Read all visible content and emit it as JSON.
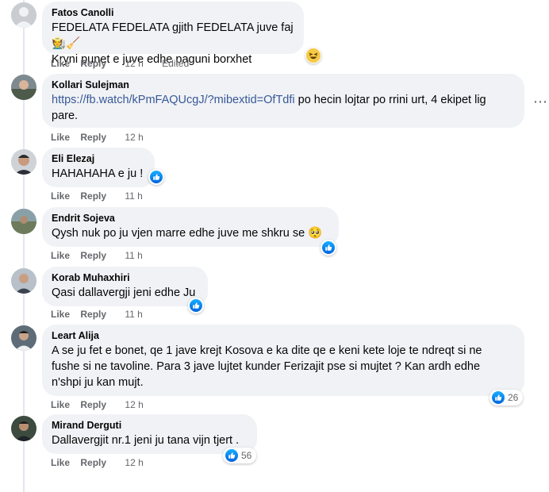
{
  "comments": [
    {
      "author": "Fatos Canolli",
      "lines": [
        "FEDELATA FEDELATA gjith FEDELATA juve faj 🧑‍🌾🧹",
        "Kryni punet e juve edhe paguni borxhet"
      ],
      "like": "Like",
      "reply": "Reply",
      "time": "12 h",
      "edited": "Edited"
    },
    {
      "author": "Kollari Sulejman",
      "link": "https://fb.watch/kPmFAQUcgJ/?mibextid=OfTdfi",
      "line1_rest": " po hecin lojtar po rrini urt, 4 ekipet lig",
      "line2": "pare.",
      "like": "Like",
      "reply": "Reply",
      "time": "12 h"
    },
    {
      "author": "Eli Elezaj",
      "lines": [
        "HAHAHAHA e ju !"
      ],
      "like": "Like",
      "reply": "Reply",
      "time": "11 h"
    },
    {
      "author": "Endrit Sojeva",
      "lines": [
        "Qysh nuk po ju vjen marre edhe juve me shkru se 🥺"
      ],
      "like": "Like",
      "reply": "Reply",
      "time": "11 h"
    },
    {
      "author": "Korab Muhaxhiri",
      "lines": [
        "Qasi dallavergji jeni edhe Ju"
      ],
      "like": "Like",
      "reply": "Reply",
      "time": "11 h"
    },
    {
      "author": "Leart Alija",
      "lines": [
        "A se ju fet e bonet, qe 1 jave krejt Kosova e ka dite qe e keni kete loje te ndreqt si ne",
        "fushe si ne tavoline. Para 3 jave lujtet kunder Ferizajit pse si mujtet ? Kan ardh edhe",
        "n'shpi ju kan mujt."
      ],
      "like": "Like",
      "reply": "Reply",
      "time": "12 h",
      "reaction_count": "26"
    },
    {
      "author": "Mirand Derguti",
      "lines": [
        "Dallavergjit nr.1 jeni ju tana vijn tjert ."
      ],
      "like": "Like",
      "reply": "Reply",
      "time": "12 h",
      "reaction_count": "56"
    }
  ],
  "colors": {
    "bubble": "#f0f2f5",
    "link": "#385898",
    "like_blue": "#0866ff",
    "meta": "#65676b"
  },
  "icons": {
    "like": "like-icon",
    "haha": "haha-icon",
    "more": "more-options-icon"
  }
}
